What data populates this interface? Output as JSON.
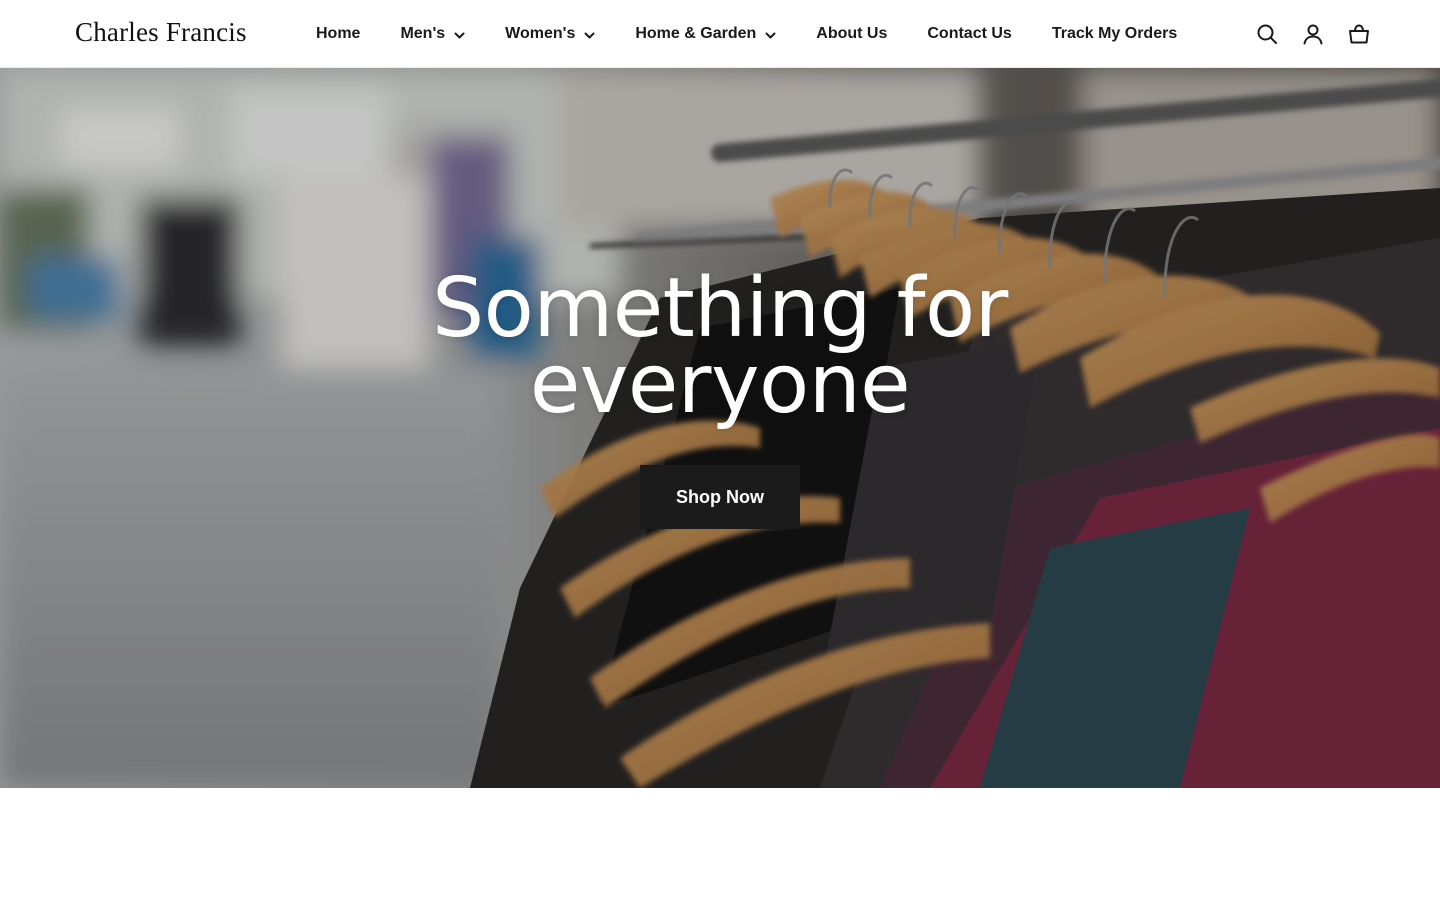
{
  "brand": {
    "logo_text": "Charles Francis"
  },
  "nav": {
    "items": [
      {
        "label": "Home",
        "has_dropdown": false
      },
      {
        "label": "Men's",
        "has_dropdown": true
      },
      {
        "label": "Women's",
        "has_dropdown": true
      },
      {
        "label": "Home & Garden",
        "has_dropdown": true
      },
      {
        "label": "About Us",
        "has_dropdown": false
      },
      {
        "label": "Contact Us",
        "has_dropdown": false
      },
      {
        "label": "Track My Orders",
        "has_dropdown": false
      }
    ]
  },
  "header_icons": [
    "search-icon",
    "account-icon",
    "cart-icon"
  ],
  "hero": {
    "title": "Something for everyone",
    "button_label": "Shop Now",
    "image_subject": "clothing rack with wooden hangers"
  },
  "colors": {
    "header_bg": "#ffffff",
    "text": "#1a1a1a",
    "button_bg": "#1b1b1b",
    "button_text": "#ffffff",
    "hero_text": "#ffffff"
  }
}
